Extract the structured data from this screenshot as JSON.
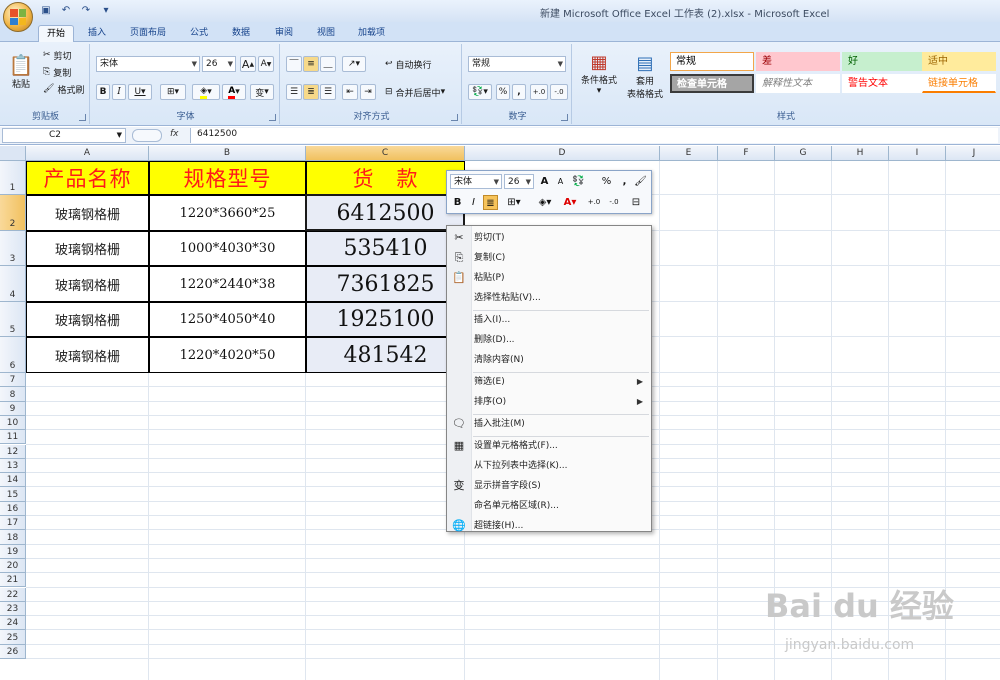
{
  "window": {
    "title": "新建 Microsoft Office Excel 工作表 (2).xlsx - Microsoft Excel"
  },
  "quick_access": [
    "save-icon",
    "undo-icon",
    "redo-icon"
  ],
  "tabs": [
    "开始",
    "插入",
    "页面布局",
    "公式",
    "数据",
    "审阅",
    "视图",
    "加载项"
  ],
  "ribbon": {
    "clipboard": {
      "label": "剪贴板",
      "paste": "粘贴",
      "cut": "剪切",
      "copy": "复制",
      "format_painter": "格式刷"
    },
    "font": {
      "label": "字体",
      "name": "宋体",
      "size": "26",
      "grow": "A",
      "shrink": "A",
      "bold": "B",
      "italic": "I",
      "underline": "U",
      "phonetic": "变"
    },
    "alignment": {
      "label": "对齐方式",
      "wrap": "自动换行",
      "merge": "合并后居中"
    },
    "number": {
      "label": "数字",
      "format": "常规",
      "percent": "%",
      "comma": ",",
      "inc_decimal": "+.0",
      "dec_decimal": "-.0"
    },
    "styles": {
      "label": "样式",
      "conditional": "条件格式",
      "table_line1": "套用",
      "table_line2": "表格格式",
      "cells": [
        {
          "text": "常规",
          "bg": "#ffffff",
          "color": "#000000"
        },
        {
          "text": "差",
          "bg": "#ffc7ce",
          "color": "#9c0006"
        },
        {
          "text": "好",
          "bg": "#c6efce",
          "color": "#006100"
        },
        {
          "text": "适中",
          "bg": "#ffeb9c",
          "color": "#9c6500"
        },
        {
          "text": "检查单元格",
          "bg": "#a5a5a5",
          "color": "#ffffff"
        },
        {
          "text": "解释性文本",
          "bg": "#ffffff",
          "color": "#7f7f7f"
        },
        {
          "text": "警告文本",
          "bg": "#ffffff",
          "color": "#ff0000"
        },
        {
          "text": "链接单元格",
          "bg": "#ffffff",
          "color": "#fa7d00"
        }
      ]
    }
  },
  "formula_bar": {
    "cell_ref": "C2",
    "fx": "fx",
    "value": "6412500"
  },
  "columns": [
    "A",
    "B",
    "C",
    "D",
    "E",
    "F",
    "G",
    "H",
    "I",
    "J"
  ],
  "rows": [
    "1",
    "2",
    "3",
    "4",
    "5",
    "6",
    "7",
    "8",
    "9",
    "10",
    "11",
    "12",
    "13",
    "14",
    "15",
    "16",
    "17",
    "18",
    "19",
    "20",
    "21",
    "22",
    "23",
    "24",
    "25",
    "26"
  ],
  "table": {
    "headers": [
      "产品名称",
      "规格型号",
      "货　款"
    ],
    "rows": [
      [
        "玻璃钢格栅",
        "1220*3660*25",
        "6412500"
      ],
      [
        "玻璃钢格栅",
        "1000*4030*30",
        "535410"
      ],
      [
        "玻璃钢格栅",
        "1220*2440*38",
        "7361825"
      ],
      [
        "玻璃钢格栅",
        "1250*4050*40",
        "1925100"
      ],
      [
        "玻璃钢格栅",
        "1220*4020*50",
        "481542"
      ]
    ]
  },
  "mini_toolbar": {
    "font": "宋体",
    "size": "26",
    "percent": "%",
    "comma": ",",
    "bold": "B",
    "italic": "I"
  },
  "context_menu": {
    "items": [
      {
        "label": "剪切(T)",
        "icon": "scissors-icon"
      },
      {
        "label": "复制(C)",
        "icon": "copy-icon"
      },
      {
        "label": "粘贴(P)",
        "icon": "paste-icon"
      },
      {
        "label": "选择性粘贴(V)...",
        "icon": ""
      },
      {
        "label": "插入(I)...",
        "icon": ""
      },
      {
        "label": "删除(D)...",
        "icon": ""
      },
      {
        "label": "清除内容(N)",
        "icon": ""
      },
      {
        "label": "筛选(E)",
        "icon": "",
        "submenu": "▶"
      },
      {
        "label": "排序(O)",
        "icon": "",
        "submenu": "▶"
      },
      {
        "label": "插入批注(M)",
        "icon": "comment-icon"
      },
      {
        "label": "设置单元格格式(F)...",
        "icon": "format-cells-icon"
      },
      {
        "label": "从下拉列表中选择(K)...",
        "icon": ""
      },
      {
        "label": "显示拼音字段(S)",
        "icon": "phonetic-icon"
      },
      {
        "label": "命名单元格区域(R)...",
        "icon": ""
      },
      {
        "label": "超链接(H)...",
        "icon": "hyperlink-icon"
      }
    ]
  },
  "watermark": {
    "main": "Bai du 经验",
    "sub": "jingyan.baidu.com"
  }
}
